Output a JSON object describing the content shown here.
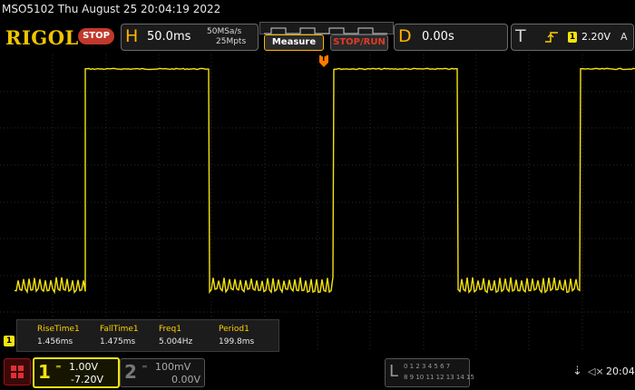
{
  "title_bar": {
    "text": "MSO5102   Thu August 25 20:04:19 2022"
  },
  "top_bar": {
    "brand": "RIGOL",
    "run_status": "STOP",
    "horizontal": {
      "letter": "H",
      "timebase": "50.0ms",
      "sample_rate": "50MSa/s",
      "memory_depth": "25Mpts"
    },
    "measure_label": "Measure",
    "stop_run_label": "STOP/RUN",
    "delay": {
      "letter": "D",
      "value": "0.00s"
    },
    "trigger": {
      "letter": "T",
      "source": "1",
      "level": "2.20V",
      "mode": "A"
    }
  },
  "measurements": [
    {
      "label": "RiseTime1",
      "value": "1.456ms"
    },
    {
      "label": "FallTime1",
      "value": "1.475ms"
    },
    {
      "label": "Freq1",
      "value": "5.004Hz"
    },
    {
      "label": "Period1",
      "value": "199.8ms"
    }
  ],
  "ch1_marker_label": "1",
  "trigger_marker_label": "T",
  "bottom_bar": {
    "channel1": {
      "number": "1",
      "scale": "1.00V",
      "offset": "-7.20V"
    },
    "channel2": {
      "number": "2",
      "scale": "100mV",
      "offset": "0.00V"
    },
    "logic": {
      "letter": "L",
      "row1": "0 1 2 3 4 5 6 7",
      "row2": "8 9 10 11 12 13 14 15"
    },
    "usb_glyph": "⇣",
    "sound_glyph": "◁×",
    "time": "20:04"
  },
  "colors": {
    "ch1": "#f5e30f",
    "accent": "#ffb400",
    "stop": "#c0392b"
  }
}
